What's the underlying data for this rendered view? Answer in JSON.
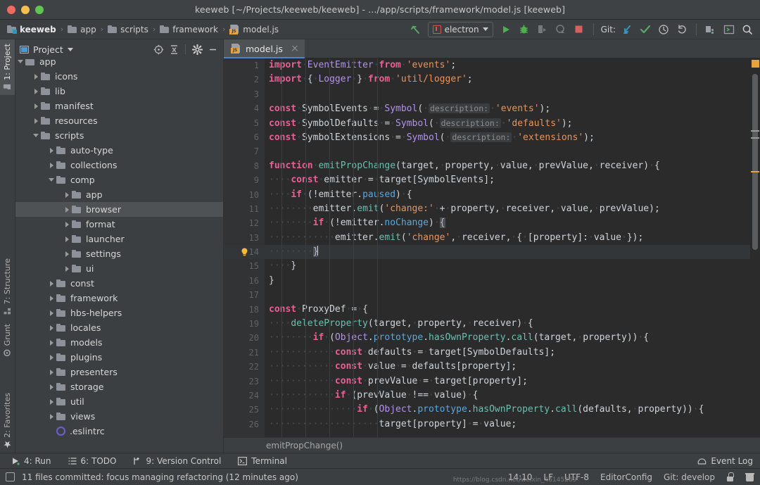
{
  "window": {
    "title": "keeweb [~/Projects/keeweb/keeweb] - .../app/scripts/framework/model.js [keeweb]"
  },
  "toolbar": {
    "breadcrumbs": [
      {
        "label": "keeweb",
        "icon": "project-folder-icon"
      },
      {
        "label": "app",
        "icon": "folder-icon"
      },
      {
        "label": "scripts",
        "icon": "folder-icon"
      },
      {
        "label": "framework",
        "icon": "folder-icon"
      },
      {
        "label": "model.js",
        "icon": "js-file-icon"
      }
    ],
    "separator": "›",
    "back_icon": "navigate-back-icon",
    "run_config": {
      "label": "electron",
      "icon": "electron-config-icon",
      "caret": "▾"
    },
    "actions": [
      {
        "name": "run-button",
        "icon": "play-icon",
        "color": "#4caf50"
      },
      {
        "name": "debug-button",
        "icon": "bug-icon",
        "color": "#4caf50"
      },
      {
        "name": "run-with-coverage-button",
        "icon": "run-coverage-icon",
        "color": "#7a7d7e"
      },
      {
        "name": "profile-button",
        "icon": "profile-icon",
        "color": "#7a7d7e"
      },
      {
        "name": "stop-button",
        "icon": "stop-icon",
        "color": "#d65f5f"
      }
    ],
    "git_label": "Git:",
    "git_actions": [
      {
        "name": "update-project-button",
        "icon": "update-arrow-icon",
        "color": "#3592c4"
      },
      {
        "name": "commit-button",
        "icon": "check-icon",
        "color": "#59a869"
      },
      {
        "name": "history-button",
        "icon": "clock-icon",
        "color": "#b0b0b0"
      },
      {
        "name": "rollback-button",
        "icon": "rollback-icon",
        "color": "#b0b0b0"
      }
    ],
    "right_actions": [
      {
        "name": "project-structure-button",
        "icon": "modules-icon"
      },
      {
        "name": "settings-button",
        "icon": "terminal-box-icon"
      },
      {
        "name": "search-everywhere-button",
        "icon": "search-icon"
      }
    ]
  },
  "left_strip": {
    "top": [
      {
        "label": "1: Project",
        "mnemonic": "1",
        "icon": "project-icon",
        "active": true
      }
    ],
    "middle": [
      {
        "label": "7: Structure",
        "mnemonic": "7",
        "icon": "structure-icon",
        "active": false
      },
      {
        "label": "Grunt",
        "mnemonic": "",
        "icon": "grunt-icon",
        "active": false
      }
    ],
    "bottom": [
      {
        "label": "2: Favorites",
        "mnemonic": "2",
        "icon": "star-icon",
        "active": false
      }
    ]
  },
  "project_panel": {
    "title": "Project",
    "title_caret": "▾",
    "header_icons": [
      {
        "name": "scroll-from-source-button",
        "icon": "target-icon"
      },
      {
        "name": "collapse-all-button",
        "icon": "collapse-all-icon"
      },
      {
        "name": "settings-gear-button",
        "icon": "gear-icon"
      },
      {
        "name": "hide-panel-button",
        "icon": "minimize-icon"
      }
    ],
    "tree": [
      {
        "label": "app",
        "depth": 1,
        "state": "open",
        "type": "folder",
        "selected": false,
        "clipped_top": true
      },
      {
        "label": "icons",
        "depth": 2,
        "state": "closed",
        "type": "folder",
        "selected": false
      },
      {
        "label": "lib",
        "depth": 2,
        "state": "closed",
        "type": "folder",
        "selected": false
      },
      {
        "label": "manifest",
        "depth": 2,
        "state": "closed",
        "type": "folder",
        "selected": false
      },
      {
        "label": "resources",
        "depth": 2,
        "state": "closed",
        "type": "folder",
        "selected": false
      },
      {
        "label": "scripts",
        "depth": 2,
        "state": "open",
        "type": "folder",
        "selected": false
      },
      {
        "label": "auto-type",
        "depth": 3,
        "state": "closed",
        "type": "folder",
        "selected": false
      },
      {
        "label": "collections",
        "depth": 3,
        "state": "closed",
        "type": "folder",
        "selected": false
      },
      {
        "label": "comp",
        "depth": 3,
        "state": "open",
        "type": "folder",
        "selected": false
      },
      {
        "label": "app",
        "depth": 4,
        "state": "closed",
        "type": "folder",
        "selected": false
      },
      {
        "label": "browser",
        "depth": 4,
        "state": "closed",
        "type": "folder",
        "selected": true
      },
      {
        "label": "format",
        "depth": 4,
        "state": "closed",
        "type": "folder",
        "selected": false
      },
      {
        "label": "launcher",
        "depth": 4,
        "state": "closed",
        "type": "folder",
        "selected": false
      },
      {
        "label": "settings",
        "depth": 4,
        "state": "closed",
        "type": "folder",
        "selected": false
      },
      {
        "label": "ui",
        "depth": 4,
        "state": "closed",
        "type": "folder",
        "selected": false
      },
      {
        "label": "const",
        "depth": 3,
        "state": "closed",
        "type": "folder",
        "selected": false
      },
      {
        "label": "framework",
        "depth": 3,
        "state": "closed",
        "type": "folder",
        "selected": false
      },
      {
        "label": "hbs-helpers",
        "depth": 3,
        "state": "closed",
        "type": "folder",
        "selected": false
      },
      {
        "label": "locales",
        "depth": 3,
        "state": "closed",
        "type": "folder",
        "selected": false
      },
      {
        "label": "models",
        "depth": 3,
        "state": "closed",
        "type": "folder",
        "selected": false
      },
      {
        "label": "plugins",
        "depth": 3,
        "state": "closed",
        "type": "folder",
        "selected": false
      },
      {
        "label": "presenters",
        "depth": 3,
        "state": "closed",
        "type": "folder",
        "selected": false
      },
      {
        "label": "storage",
        "depth": 3,
        "state": "closed",
        "type": "folder",
        "selected": false
      },
      {
        "label": "util",
        "depth": 3,
        "state": "closed",
        "type": "folder",
        "selected": false
      },
      {
        "label": "views",
        "depth": 3,
        "state": "closed",
        "type": "folder",
        "selected": false
      },
      {
        "label": ".eslintrc",
        "depth": 3,
        "state": "none",
        "type": "eslint",
        "selected": false
      }
    ]
  },
  "editor": {
    "tabs": [
      {
        "label": "model.js",
        "icon": "js-file-icon",
        "active": true,
        "close_icon": "close-icon"
      }
    ],
    "breadcrumb": "emitPropChange()",
    "current_line": 14,
    "first_line": 1,
    "last_line": 26,
    "gutter_icons": [
      {
        "line": 14,
        "icon": "intention-bulb-icon",
        "color": "#f5bb40"
      }
    ],
    "lines": [
      {
        "n": 1,
        "text": "import EventEmitter from 'events';"
      },
      {
        "n": 2,
        "text": "import { Logger } from 'util/logger';"
      },
      {
        "n": 3,
        "text": ""
      },
      {
        "n": 4,
        "text": "const SymbolEvents = Symbol( description: 'events');"
      },
      {
        "n": 5,
        "text": "const SymbolDefaults = Symbol( description: 'defaults');"
      },
      {
        "n": 6,
        "text": "const SymbolExtensions = Symbol( description: 'extensions');"
      },
      {
        "n": 7,
        "text": ""
      },
      {
        "n": 8,
        "text": "function emitPropChange(target, property, value, prevValue, receiver) {"
      },
      {
        "n": 9,
        "text": "    const emitter = target[SymbolEvents];"
      },
      {
        "n": 10,
        "text": "    if (!emitter.paused) {"
      },
      {
        "n": 11,
        "text": "        emitter.emit('change:' + property, receiver, value, prevValue);"
      },
      {
        "n": 12,
        "text": "        if (!emitter.noChange) {"
      },
      {
        "n": 13,
        "text": "            emitter.emit('change', receiver, { [property]: value });"
      },
      {
        "n": 14,
        "text": "        }"
      },
      {
        "n": 15,
        "text": "    }"
      },
      {
        "n": 16,
        "text": "}"
      },
      {
        "n": 17,
        "text": ""
      },
      {
        "n": 18,
        "text": "const ProxyDef = {"
      },
      {
        "n": 19,
        "text": "    deleteProperty(target, property, receiver) {"
      },
      {
        "n": 20,
        "text": "        if (Object.prototype.hasOwnProperty.call(target, property)) {"
      },
      {
        "n": 21,
        "text": "            const defaults = target[SymbolDefaults];"
      },
      {
        "n": 22,
        "text": "            const value = defaults[property];"
      },
      {
        "n": 23,
        "text": "            const prevValue = target[property];"
      },
      {
        "n": 24,
        "text": "            if (prevValue !== value) {"
      },
      {
        "n": 25,
        "text": "                if (Object.prototype.hasOwnProperty.call(defaults, property)) {"
      },
      {
        "n": 26,
        "text": "                    target[property] = value;"
      }
    ],
    "inlay_hints": [
      "description:"
    ]
  },
  "bottom_tool_windows": [
    {
      "label": "4: Run",
      "mnemonic": "4",
      "icon": "run-icon"
    },
    {
      "label": "6: TODO",
      "mnemonic": "6",
      "icon": "todo-list-icon"
    },
    {
      "label": "9: Version Control",
      "mnemonic": "9",
      "icon": "vcs-branch-icon"
    },
    {
      "label": "Terminal",
      "mnemonic": "",
      "icon": "terminal-icon"
    }
  ],
  "event_log": {
    "label": "Event Log",
    "icon": "event-log-icon"
  },
  "status_bar": {
    "message": "11 files committed: focus managing refactoring (12 minutes ago)",
    "message_icon": "message-icon",
    "caret_position": "14:10",
    "line_separator": "LF",
    "encoding": "UTF-8",
    "editor_config": "EditorConfig",
    "git_branch": "Git: develop",
    "lock_icon": "lock-icon",
    "trash_icon": "trash-icon",
    "watermark": "https://blog.csdn.net/weixin_46145269"
  },
  "colors": {
    "window_chrome": "#3c3f41",
    "editor_bg": "#2b2b2b",
    "gutter_bg": "#313335",
    "selection": "#4e5254",
    "tab_underline": "#4a88c7",
    "keyword": "#cc7832",
    "keyword_pink": "#ec5f93",
    "string": "#e8955c",
    "function": "#6bbfb0",
    "class": "#b392ec",
    "property": "#57a8e0",
    "warning": "#e8a33d",
    "green": "#59a869",
    "red": "#d65f5f",
    "blue": "#3592c4"
  }
}
